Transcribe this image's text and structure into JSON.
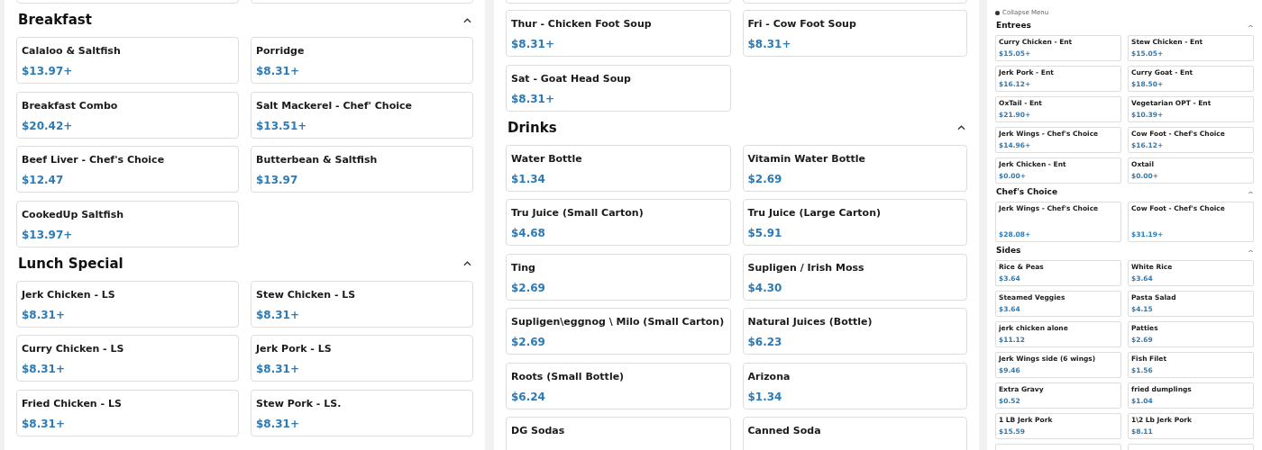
{
  "panels": [
    {
      "cut_top": true,
      "cut_bottom": false,
      "sections": [
        {
          "title": "Breakfast",
          "expanded": true,
          "items": [
            {
              "name": "Calaloo & Saltfish",
              "price": "$13.97+"
            },
            {
              "name": "Porridge",
              "price": "$8.31+"
            },
            {
              "name": "Breakfast Combo",
              "price": "$20.42+"
            },
            {
              "name": "Salt Mackerel - Chef' Choice",
              "price": "$13.51+"
            },
            {
              "name": "Beef Liver - Chef's Choice",
              "price": "$12.47"
            },
            {
              "name": "Butterbean & Saltfish",
              "price": "$13.97"
            },
            {
              "name": "CookedUp Saltfish",
              "price": "$13.97+"
            }
          ]
        },
        {
          "title": "Lunch Special",
          "expanded": true,
          "items": [
            {
              "name": "Jerk Chicken - LS",
              "price": "$8.31+"
            },
            {
              "name": "Stew Chicken - LS",
              "price": "$8.31+"
            },
            {
              "name": "Curry Chicken - LS",
              "price": "$8.31+"
            },
            {
              "name": "Jerk Pork - LS",
              "price": "$8.31+"
            },
            {
              "name": "Fried Chicken - LS",
              "price": "$8.31+"
            },
            {
              "name": "Stew Pork - LS.",
              "price": "$8.31+"
            }
          ]
        }
      ]
    },
    {
      "cut_top": true,
      "cut_bottom": false,
      "sections": [
        {
          "items": [
            {
              "name": "Thur - Chicken Foot Soup",
              "price": "$8.31+"
            },
            {
              "name": "Fri - Cow Foot Soup",
              "price": "$8.31+"
            },
            {
              "name": "Sat - Goat Head Soup",
              "price": "$8.31+"
            }
          ]
        },
        {
          "title": "Drinks",
          "expanded": true,
          "items": [
            {
              "name": "Water Bottle",
              "price": "$1.34"
            },
            {
              "name": "Vitamin Water Bottle",
              "price": "$2.69"
            },
            {
              "name": "Tru Juice (Small Carton)",
              "price": "$4.68"
            },
            {
              "name": "Tru Juice (Large Carton)",
              "price": "$5.91"
            },
            {
              "name": "Ting",
              "price": "$2.69"
            },
            {
              "name": "Supligen / Irish Moss",
              "price": "$4.30"
            },
            {
              "name": "Supligen\\eggnog \\ Milo (Small Carton)",
              "price": "$2.69"
            },
            {
              "name": "Natural Juices (Bottle)",
              "price": "$6.23"
            },
            {
              "name": "Roots (Small Bottle)",
              "price": "$6.24"
            },
            {
              "name": "Arizona",
              "price": "$1.34"
            },
            {
              "name": "DG Sodas"
            },
            {
              "name": "Canned Soda"
            }
          ]
        }
      ]
    },
    {
      "collapse_menu": "Collapse Menu",
      "cut_top": false,
      "cut_bottom": true,
      "sections": [
        {
          "title": "Entrees",
          "expanded": true,
          "items": [
            {
              "name": "Curry Chicken - Ent",
              "price": "$15.05+"
            },
            {
              "name": "Stew Chicken - Ent",
              "price": "$15.05+"
            },
            {
              "name": "Jerk Pork - Ent",
              "price": "$16.12+"
            },
            {
              "name": "Curry Goat - Ent",
              "price": "$18.50+"
            },
            {
              "name": "OxTail - Ent",
              "price": "$21.90+"
            },
            {
              "name": "Vegetarian OPT - Ent",
              "price": "$10.39+"
            },
            {
              "name": "Jerk Wings - Chef's Choice",
              "price": "$14.96+"
            },
            {
              "name": "Cow Foot - Chef's Choice",
              "price": "$16.12+"
            },
            {
              "name": "Jerk Chicken - Ent",
              "price": "$0.00+"
            },
            {
              "name": "Oxtail",
              "price": "$0.00+"
            }
          ]
        },
        {
          "title": "Chef's Choice",
          "expanded": true,
          "tall": true,
          "items": [
            {
              "name": "Jerk Wings - Chef's Choice",
              "price": "$28.08+"
            },
            {
              "name": "Cow Foot - Chef's Choice",
              "price": "$31.19+"
            }
          ]
        },
        {
          "title": "Sides",
          "expanded": true,
          "items": [
            {
              "name": "Rice & Peas",
              "price": "$3.64"
            },
            {
              "name": "White Rice",
              "price": "$3.64"
            },
            {
              "name": "Steamed Veggies",
              "price": "$3.64"
            },
            {
              "name": "Pasta Salad",
              "price": "$4.15"
            },
            {
              "name": "jerk chicken alone",
              "price": "$11.12"
            },
            {
              "name": "Patties",
              "price": "$2.69"
            },
            {
              "name": "Jerk Wings side (6 wings)",
              "price": "$9.46"
            },
            {
              "name": "Fish Filet",
              "price": "$1.56"
            },
            {
              "name": "Extra Gravy",
              "price": "$0.52"
            },
            {
              "name": "fried dumplings",
              "price": "$1.04"
            },
            {
              "name": "1 LB Jerk Pork",
              "price": "$15.59"
            },
            {
              "name": "1\\2 Lb Jerk Pork",
              "price": "$8.11"
            }
          ]
        }
      ]
    }
  ]
}
